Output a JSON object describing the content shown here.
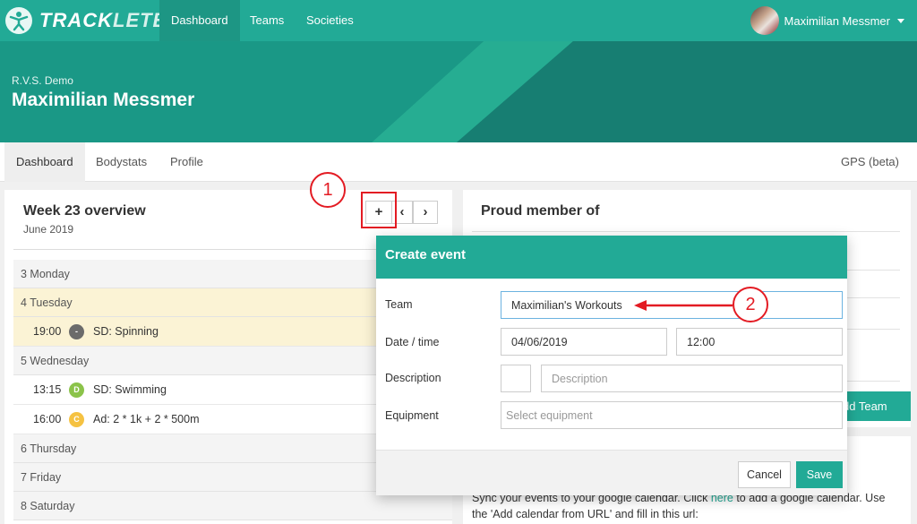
{
  "navbar": {
    "logo_part1": "TRACK",
    "logo_part2": "LETE",
    "items": [
      {
        "label": "Dashboard",
        "active": true
      },
      {
        "label": "Teams",
        "active": false
      },
      {
        "label": "Societies",
        "active": false
      }
    ],
    "user_name": "Maximilian Messmer"
  },
  "hero": {
    "organization": "R.V.S. Demo",
    "name": "Maximilian Messmer"
  },
  "tabs": {
    "items": [
      {
        "label": "Dashboard",
        "active": true
      },
      {
        "label": "Bodystats",
        "active": false
      },
      {
        "label": "Profile",
        "active": false
      }
    ],
    "right_label": "GPS (beta)"
  },
  "overview": {
    "title": "Week 23 overview",
    "subtitle": "June 2019",
    "plus_label": "+",
    "prev_label": "‹",
    "next_label": "›",
    "days": [
      {
        "label": "3  Monday",
        "highlight": false,
        "events": []
      },
      {
        "label": "4  Tuesday",
        "highlight": true,
        "events": [
          {
            "time": "19:00",
            "badge": "-",
            "badge_color": "#6b6b6b",
            "title": "SD:  Spinning"
          }
        ]
      },
      {
        "label": "5  Wednesday",
        "highlight": false,
        "events": [
          {
            "time": "13:15",
            "badge": "D",
            "badge_color": "#8bc34a",
            "title": "SD:  Swimming"
          },
          {
            "time": "16:00",
            "badge": "C",
            "badge_color": "#f5c242",
            "title": "Ad:  2 * 1k + 2 * 500m"
          }
        ]
      },
      {
        "label": "6  Thursday",
        "highlight": false,
        "events": []
      },
      {
        "label": "7  Friday",
        "highlight": false,
        "events": []
      },
      {
        "label": "8  Saturday",
        "highlight": false,
        "events": []
      }
    ]
  },
  "proud": {
    "title": "Proud member of",
    "add_team_label": "dd Team"
  },
  "sync": {
    "text_before": "Sync your events to your google calendar. Click ",
    "link": "here",
    "text_after": " to add a google calendar. Use the 'Add calendar from URL' and fill in this url:"
  },
  "modal": {
    "title": "Create event",
    "team_label": "Team",
    "team_value": "Maximilian's Workouts",
    "datetime_label": "Date / time",
    "date_value": "04/06/2019",
    "time_value": "12:00",
    "description_label": "Description",
    "description_placeholder": "Description",
    "equipment_label": "Equipment",
    "equipment_placeholder": "Select equipment",
    "cancel_label": "Cancel",
    "save_label": "Save"
  },
  "annotations": {
    "step1": "1",
    "step2": "2"
  },
  "colors": {
    "brand": "#22aa96",
    "highlight": "#fbf3d5",
    "annotation": "#e31b23"
  }
}
